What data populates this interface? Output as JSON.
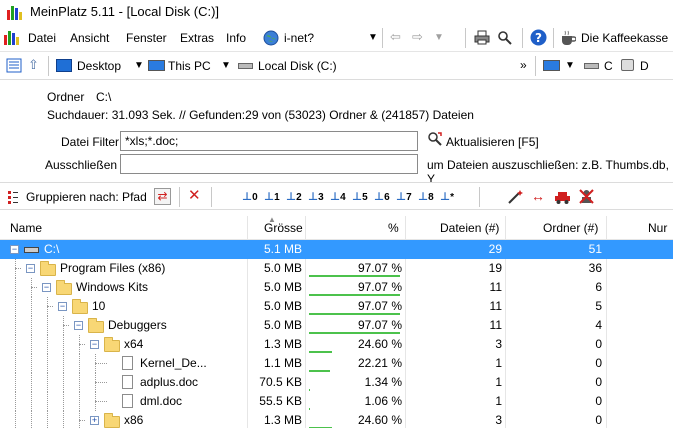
{
  "window": {
    "title": "MeinPlatz 5.11 - [Local Disk (C:)]"
  },
  "menu": {
    "items": [
      "Datei",
      "Ansicht",
      "Fenster",
      "Extras",
      "Info"
    ],
    "inet": "i-net?",
    "kaffee": "Die Kaffeekasse"
  },
  "address": {
    "desktop": "Desktop",
    "thispc": "This PC",
    "disk": "Local Disk (C:)",
    "drive_c": "C",
    "drive_d": "D"
  },
  "info": {
    "ordner_label": "Ordner",
    "ordner_value": "C:\\",
    "summary": "Suchdauer: 31.093 Sek. //  Gefunden:29 von (53023) Ordner & (241857) Dateien",
    "filter_label": "Datei Filter",
    "filter_value": "*xls;*.doc;",
    "refresh_label": "Aktualisieren [F5]",
    "exclude_label": "Ausschließen",
    "exclude_value": "",
    "exclude_hint": "um Dateien auszuschließen: z.B. Thumbs.db, Y"
  },
  "groupbar": {
    "label": "Gruppieren nach: Pfad",
    "levels": [
      "0",
      "1",
      "2",
      "3",
      "4",
      "5",
      "6",
      "7",
      "8",
      "*"
    ]
  },
  "table": {
    "headers": {
      "name": "Name",
      "size": "Grösse",
      "pct": "%",
      "files": "Dateien (#)",
      "folders": "Ordner (#)",
      "num": "Nur"
    },
    "rows": [
      {
        "name": "C:\\",
        "size": "5.1 MB",
        "pct": "",
        "pct_value": 0,
        "files": "29",
        "folders": "51",
        "level": 0,
        "kind": "drive",
        "expander": "−"
      },
      {
        "name": "Program Files (x86)",
        "size": "5.0 MB",
        "pct": "97.07 %",
        "pct_value": 97.07,
        "files": "19",
        "folders": "36",
        "level": 1,
        "kind": "folder",
        "expander": "−"
      },
      {
        "name": "Windows Kits",
        "size": "5.0 MB",
        "pct": "97.07 %",
        "pct_value": 97.07,
        "files": "11",
        "folders": "6",
        "level": 2,
        "kind": "folder",
        "expander": "−"
      },
      {
        "name": "10",
        "size": "5.0 MB",
        "pct": "97.07 %",
        "pct_value": 97.07,
        "files": "11",
        "folders": "5",
        "level": 3,
        "kind": "folder",
        "expander": "−"
      },
      {
        "name": "Debuggers",
        "size": "5.0 MB",
        "pct": "97.07 %",
        "pct_value": 97.07,
        "files": "11",
        "folders": "4",
        "level": 4,
        "kind": "folder",
        "expander": "−"
      },
      {
        "name": "x64",
        "size": "1.3 MB",
        "pct": "24.60 %",
        "pct_value": 24.6,
        "files": "3",
        "folders": "0",
        "level": 5,
        "kind": "folder",
        "expander": "−"
      },
      {
        "name": "Kernel_De...",
        "size": "1.1 MB",
        "pct": "22.21 %",
        "pct_value": 22.21,
        "files": "1",
        "folders": "0",
        "level": 6,
        "kind": "file",
        "expander": ""
      },
      {
        "name": "adplus.doc",
        "size": "70.5 KB",
        "pct": "1.34 %",
        "pct_value": 1.34,
        "files": "1",
        "folders": "0",
        "level": 6,
        "kind": "file",
        "expander": ""
      },
      {
        "name": "dml.doc",
        "size": "55.5 KB",
        "pct": "1.06 %",
        "pct_value": 1.06,
        "files": "1",
        "folders": "0",
        "level": 6,
        "kind": "file",
        "expander": ""
      },
      {
        "name": "x86",
        "size": "1.3 MB",
        "pct": "24.60 %",
        "pct_value": 24.6,
        "files": "3",
        "folders": "0",
        "level": 5,
        "kind": "folder",
        "expander": "+"
      }
    ]
  },
  "colors": {
    "selection": "#3399ff",
    "progress": "#4cc24c",
    "folder": "#f8d775"
  }
}
